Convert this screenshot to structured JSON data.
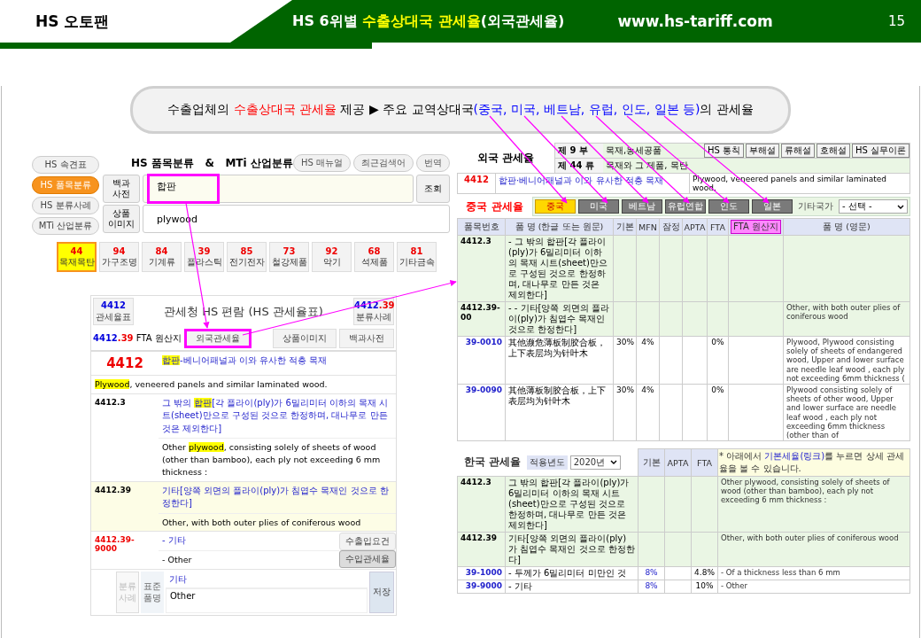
{
  "header": {
    "brand": "HS 오토팬",
    "title": [
      {
        "text": "HS 6위별 ",
        "accent": false
      },
      {
        "text": "수출상대국 관세율",
        "accent": true
      },
      {
        "text": "(외국관세율)",
        "accent": false
      }
    ],
    "url": "www.hs-tariff.com",
    "page_number": "15"
  },
  "banner": {
    "parts": [
      {
        "text": "수출업체의 ",
        "kind": "plain"
      },
      {
        "text": "수출상대국 관세율",
        "kind": "red"
      },
      {
        "text": " 제공 ▶ 주요 교역상대국",
        "kind": "plain"
      },
      {
        "text": "(중국, 미국, 베트남, 유럽, 인도, 일본 등)",
        "kind": "blue"
      },
      {
        "text": "의 관세율",
        "kind": "plain"
      }
    ]
  },
  "classifier": {
    "nav": [
      {
        "label": "HS 속견표",
        "selected": false
      },
      {
        "label": "HS 품목분류",
        "selected": true
      },
      {
        "label": "HS 분류사례",
        "selected": false
      },
      {
        "label": "MTi 산업분류",
        "selected": false
      }
    ],
    "title": "HS 품목분류   &   MTi 산업분류",
    "tools": [
      "HS 매뉴얼",
      "최근검색어",
      "번역"
    ],
    "fields": [
      {
        "label": "백과 사전",
        "value": "합판",
        "callout": true,
        "button": "조회"
      },
      {
        "label": "상품 이미지",
        "value": "plywood",
        "callout": false
      }
    ],
    "categories": [
      {
        "code": "44",
        "name": "목재목탄",
        "selected": true
      },
      {
        "code": "94",
        "name": "가구조명",
        "selected": false
      },
      {
        "code": "84",
        "name": "기계류",
        "selected": false
      },
      {
        "code": "39",
        "name": "플라스틱",
        "selected": false
      },
      {
        "code": "85",
        "name": "전기전자",
        "selected": false
      },
      {
        "code": "73",
        "name": "철강제품",
        "selected": false
      },
      {
        "code": "92",
        "name": "악기",
        "selected": false
      },
      {
        "code": "68",
        "name": "석제품",
        "selected": false
      },
      {
        "code": "81",
        "name": "기타금속",
        "selected": false
      }
    ]
  },
  "tariff_book": {
    "left_box": {
      "code": "4412",
      "label": "관세율표"
    },
    "title": "관세청 HS 편람 (HS 관세율표)",
    "right_box": {
      "code": "4412",
      "sub": ".39",
      "label": "분류사례"
    },
    "fta": {
      "code": "4412",
      "sub": ".39",
      "label": "FTA 원산지"
    },
    "buttons": [
      {
        "label": "외국관세율",
        "callout": true
      },
      {
        "label": "상품이미지",
        "callout": false
      },
      {
        "label": "백과사전",
        "callout": false
      }
    ],
    "heading": {
      "code": "4412",
      "korean": [
        {
          "text": "합판",
          "highlight": true
        },
        {
          "text": "-베니어패널과 이와 유사한 적층 목재",
          "highlight": false
        }
      ],
      "english": [
        {
          "text": "Plywood",
          "highlight": true
        },
        {
          "text": ", veneered panels and similar laminated wood.",
          "highlight": false
        }
      ]
    },
    "entries": [
      {
        "code": "4412.3",
        "shaded": false,
        "korean": [
          {
            "text": "그 밖의 ",
            "highlight": false
          },
          {
            "text": "합판",
            "highlight": true
          },
          {
            "text": "[각 플라이(ply)가 6밀리미터 이하의 목재 시트(sheet)만으로 구성된 것으로 한정하며, 대나무로 만든 것은 제외한다]",
            "highlight": false
          }
        ],
        "english": [
          {
            "text": "Other ",
            "highlight": false
          },
          {
            "text": "plywood",
            "highlight": true
          },
          {
            "text": ", consisting solely of sheets of wood (other than bamboo), each ply not exceeding 6 mm thickness :",
            "highlight": false
          }
        ]
      },
      {
        "code": "4412.39",
        "shaded": true,
        "korean": [
          {
            "text": "기타[양쪽 외면의 플라이(ply)가 침엽수 목재인 것으로 한정한다]",
            "highlight": false
          }
        ],
        "english": [
          {
            "text": "Other, with both outer plies of coniferous wood",
            "highlight": false
          }
        ]
      }
    ],
    "item": {
      "code": "4412.39-9000",
      "korean": "- 기타",
      "english": "- Other",
      "buttons": [
        {
          "label": "수출입요건",
          "pressed": false
        },
        {
          "label": "수입관세율",
          "pressed": true
        }
      ]
    },
    "standard": {
      "case_button": "분류 사례",
      "case_disabled": true,
      "label": "표준 품명",
      "korean": "기타",
      "english": "Other",
      "save": "저장"
    }
  },
  "foreign": {
    "title": "외국 관세율",
    "section": [
      {
        "label": "제 9 부",
        "value": "목재,농세공품"
      },
      {
        "label": "제 44 류",
        "value": "목재와 그 제품, 목탄"
      }
    ],
    "doc_buttons": [
      "HS 통칙",
      "부해설",
      "류해설",
      "호해설",
      "HS 실무이론"
    ],
    "heading": {
      "code": "4412",
      "korean": "합판·베니어패널과 이와 유사한 적층 목재",
      "english": "Plywood, veneered panels and similar laminated wood."
    },
    "country_title": "중국 관세율",
    "countries": [
      {
        "label": "중국",
        "selected": true
      },
      {
        "label": "미국",
        "selected": false
      },
      {
        "label": "베트남",
        "selected": false
      },
      {
        "label": "유럽연합",
        "selected": false
      },
      {
        "label": "인도",
        "selected": false
      },
      {
        "label": "일본",
        "selected": false
      }
    ],
    "other_label": "기타국가",
    "other_select": "- 선택 -",
    "columns": [
      {
        "label": "품목번호",
        "kind": "text"
      },
      {
        "label": "품 명 (한글 또는 원문)",
        "kind": "text"
      },
      {
        "label": "기본",
        "kind": "text"
      },
      {
        "label": "MFN",
        "kind": "text"
      },
      {
        "label": "잠정",
        "kind": "text"
      },
      {
        "label": "APTA",
        "kind": "text"
      },
      {
        "label": "FTA",
        "kind": "text"
      },
      {
        "label": "FTA 원산지",
        "kind": "button"
      },
      {
        "label": "품 명 (영문)",
        "kind": "text"
      }
    ],
    "rows": [
      {
        "kind": "heading",
        "code": "4412.3",
        "name": "- 그 밖의 합판[각 플라이(ply)가 6밀리미터 이하의 목재 시트(sheet)만으로 구성된 것으로 한정하며, 대나무로 만든 것은 제외한다]"
      },
      {
        "kind": "heading",
        "code": "4412.39-00",
        "name": "- - 기타[양쪽 외면의 플라이(ply)가 침엽수 목재인 것으로 한정한다]",
        "english": "Other, with both outer plies of coniferous wood"
      },
      {
        "kind": "item",
        "code": "39-0010",
        "name": "其他濒危薄板制胶合板，上下表层均为针叶木",
        "basic": "30%",
        "mfn": "4%",
        "fta": "0%",
        "english": "Plywood, Plywood consisting solely of sheets of endangered wood, Upper and lower surface are needle leaf wood , each ply not exceeding 6mm thickness ("
      },
      {
        "kind": "item",
        "code": "39-0090",
        "name": "其他薄板制胶合板，上下表层均为针叶木",
        "basic": "30%",
        "mfn": "4%",
        "fta": "0%",
        "english": "Plywood consisting solely of sheets of other wood, Upper and lower surface are needle leaf wood , each ply not exceeding 6mm thickness (other than of"
      }
    ]
  },
  "korea": {
    "title": "한국 관세율",
    "year_label": "적용년도",
    "year": "2020년",
    "columns": [
      "기본",
      "APTA",
      "FTA"
    ],
    "note": [
      {
        "text": "* 아래에서 ",
        "link": false
      },
      {
        "text": "기본세율(링크)",
        "link": true
      },
      {
        "text": "를 누르면 상세 관세율을 볼 수 있습니다.",
        "link": false
      }
    ],
    "rows": [
      {
        "kind": "heading",
        "code": "4412.3",
        "name": "그 밖의 합판[각 플라이(ply)가 6밀리미터 이하의 목재 시트(sheet)만으로 구성된 것으로 한정하며, 대나무로 만든 것은 제외한다]",
        "english": "Other plywood, consisting solely of sheets of wood (other than bamboo), each ply not exceeding 6 mm thickness :"
      },
      {
        "kind": "heading",
        "code": "4412.39",
        "name": "기타[양쪽 외면의 플라이(ply)가 침엽수 목재인 것으로 한정한다]",
        "english": "Other, with both outer plies of coniferous wood"
      },
      {
        "kind": "item",
        "code": "39-1000",
        "name": "- 두께가 6밀리미터 미만인 것",
        "basic": "8%",
        "fta": "4.8%",
        "english": "- Of a thickness less than 6 mm"
      },
      {
        "kind": "item",
        "code": "39-9000",
        "name": "- 기타",
        "basic": "8%",
        "fta": "10%",
        "english": "- Other"
      }
    ]
  }
}
